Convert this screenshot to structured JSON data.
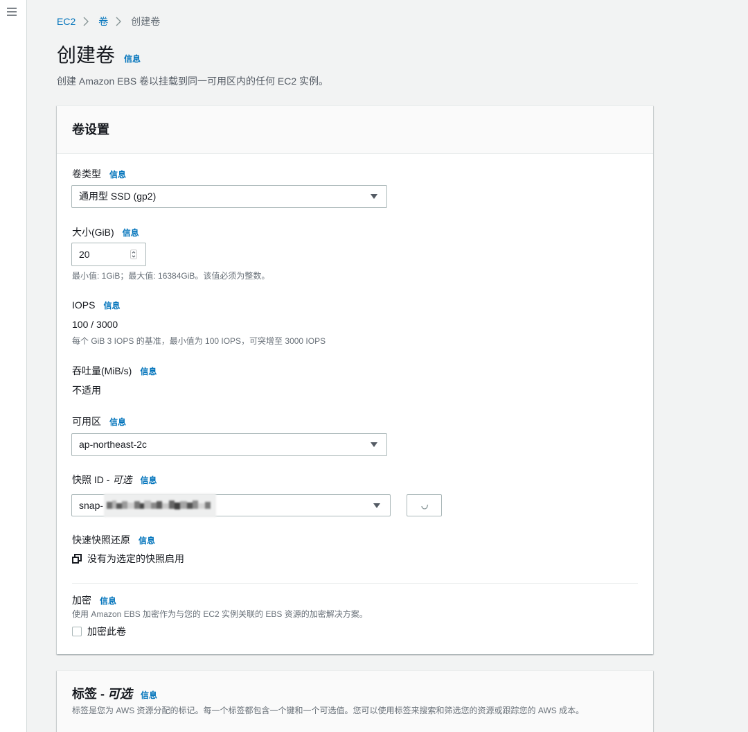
{
  "colors": {
    "accent": "#0073bb",
    "text": "#16191f",
    "secondary_text": "#687078",
    "border": "#aab7b8",
    "page_background": "#f2f3f3",
    "header_background": "#fafafa"
  },
  "sidebar": {
    "menu_icon": "hamburger-menu-icon"
  },
  "breadcrumb": {
    "separator_icon": "chevron-right-icon",
    "items": [
      {
        "label": "EC2"
      },
      {
        "label": "卷"
      },
      {
        "label": "创建卷"
      }
    ]
  },
  "header": {
    "title": "创建卷",
    "info": "信息",
    "description": "创建 Amazon EBS 卷以挂载到同一可用区内的任何 EC2 实例。"
  },
  "volume_settings": {
    "title": "卷设置",
    "dropdown_icon": "caret-down-icon",
    "volume_type": {
      "label": "卷类型",
      "info": "信息",
      "value": "通用型 SSD (gp2)"
    },
    "size": {
      "label": "大小(GiB)",
      "info": "信息",
      "value": "20",
      "constraint": "最小值: 1GiB；最大值: 16384GiB。该值必须为整数。"
    },
    "iops": {
      "label": "IOPS",
      "info": "信息",
      "value": "100 / 3000",
      "description": "每个 GiB 3 IOPS 的基准，最小值为 100 IOPS，可突增至 3000 IOPS"
    },
    "throughput": {
      "label": "吞吐量(MiB/s)",
      "info": "信息",
      "value": "不适用"
    },
    "availability_zone": {
      "label": "可用区",
      "info": "信息",
      "value": "ap-northeast-2c"
    },
    "snapshot_id": {
      "label": "快照 ID -",
      "optional": "可选",
      "info": "信息",
      "value": "snap-",
      "refresh_icon": "refresh-icon"
    },
    "fast_snapshot_restore": {
      "label": "快速快照还原",
      "info": "信息",
      "status": "没有为选定的快照启用",
      "status_icon": "copy-icon"
    },
    "encryption": {
      "label": "加密",
      "info": "信息",
      "description": "使用 Amazon EBS 加密作为与您的 EC2 实例关联的 EBS 资源的加密解决方案。",
      "checkbox_label": "加密此卷",
      "checked": false
    }
  },
  "tags": {
    "title": "标签 -",
    "optional": "可选",
    "info": "信息",
    "description": "标签是您为 AWS 资源分配的标记。每一个标签都包含一个键和一个可选值。您可以使用标签来搜索和筛选您的资源或跟踪您的 AWS 成本。"
  }
}
